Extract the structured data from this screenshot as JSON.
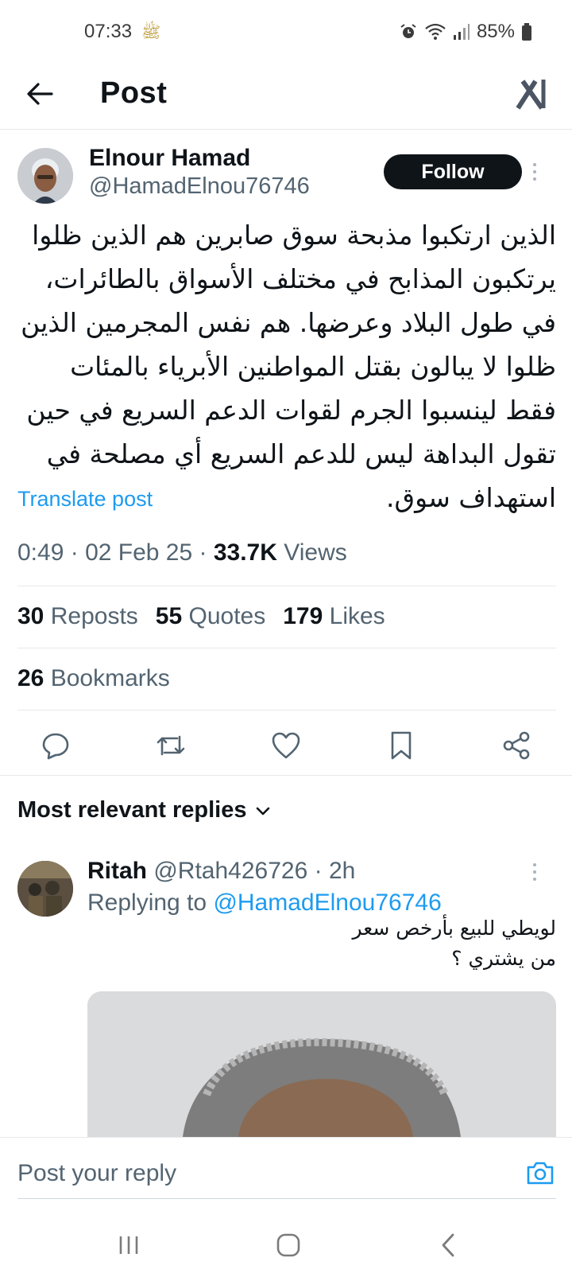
{
  "status_bar": {
    "time": "07:33",
    "emoji": "ﷺ",
    "battery": "85%"
  },
  "header": {
    "title": "Post"
  },
  "post": {
    "author_name": "Elnour Hamad",
    "author_handle": "@HamadElnou76746",
    "follow_label": "Follow",
    "text": "الذين ارتكبوا مذبحة سوق صابرين هم الذين ظلوا يرتكبون المذابح  في مختلف الأسواق بالطائرات، في طول البلاد وعرضها. هم نفس المجرمين الذين ظلوا لا يبالون بقتل المواطنين الأبرياء بالمئات فقط لينسبوا الجرم لقوات الدعم السريع في حين تقول البداهة ليس للدعم السريع أي مصلحة في استهداف سوق.",
    "translate_label": "Translate post",
    "time": "0:49",
    "date": "02 Feb 25",
    "views_count": "33.7K",
    "views_label": "Views",
    "reposts_count": "30",
    "reposts_label": "Reposts",
    "quotes_count": "55",
    "quotes_label": "Quotes",
    "likes_count": "179",
    "likes_label": "Likes",
    "bookmarks_count": "26",
    "bookmarks_label": "Bookmarks"
  },
  "replies": {
    "heading": "Most relevant replies",
    "items": [
      {
        "name": "Ritah",
        "handle": "@Rtah426726",
        "age": "2h",
        "replying_prefix": "Replying to",
        "replying_handle": "@HamadElnou76746",
        "line1": "لويطي للبيع بأرخص سعر",
        "line2": "من يشتري ؟"
      }
    ]
  },
  "composer": {
    "placeholder": "Post your reply"
  },
  "colors": {
    "accent": "#1d9bf0",
    "text": "#0f1419",
    "secondary": "#536471"
  }
}
